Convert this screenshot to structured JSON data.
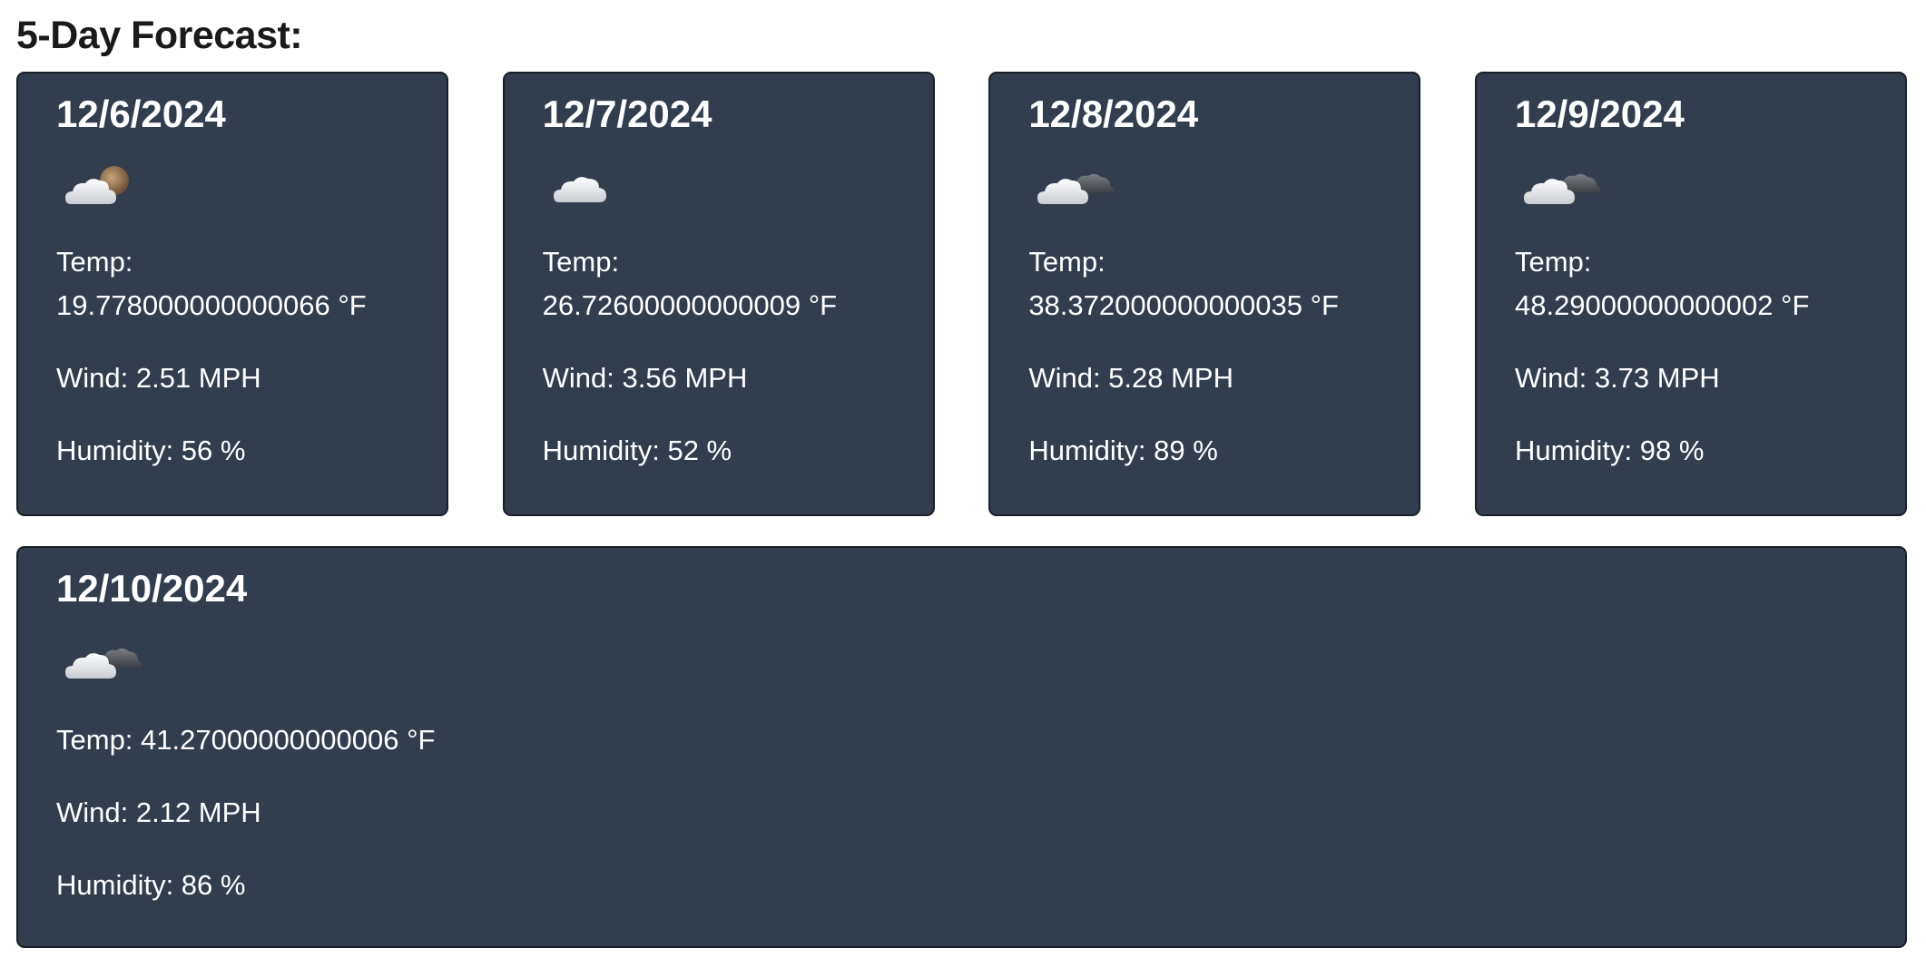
{
  "forecast": {
    "title": "5-Day Forecast:",
    "days": [
      {
        "date": "12/6/2024",
        "icon": "partly-cloudy-night-icon",
        "temp_label": "Temp:",
        "temp_value": "19.778000000000066 °F",
        "wind": "Wind: 2.51 MPH",
        "humidity": "Humidity: 56 %"
      },
      {
        "date": "12/7/2024",
        "icon": "cloud-icon",
        "temp_label": "Temp:",
        "temp_value": "26.72600000000009 °F",
        "wind": "Wind: 3.56 MPH",
        "humidity": "Humidity: 52 %"
      },
      {
        "date": "12/8/2024",
        "icon": "broken-clouds-icon",
        "temp_label": "Temp:",
        "temp_value": "38.372000000000035 °F",
        "wind": "Wind: 5.28 MPH",
        "humidity": "Humidity: 89 %"
      },
      {
        "date": "12/9/2024",
        "icon": "broken-clouds-icon",
        "temp_label": "Temp:",
        "temp_value": "48.29000000000002 °F",
        "wind": "Wind: 3.73 MPH",
        "humidity": "Humidity: 98 %"
      },
      {
        "date": "12/10/2024",
        "icon": "broken-clouds-icon",
        "temp": "Temp: 41.27000000000006 °F",
        "wind": "Wind: 2.12 MPH",
        "humidity": "Humidity: 86 %"
      }
    ]
  }
}
